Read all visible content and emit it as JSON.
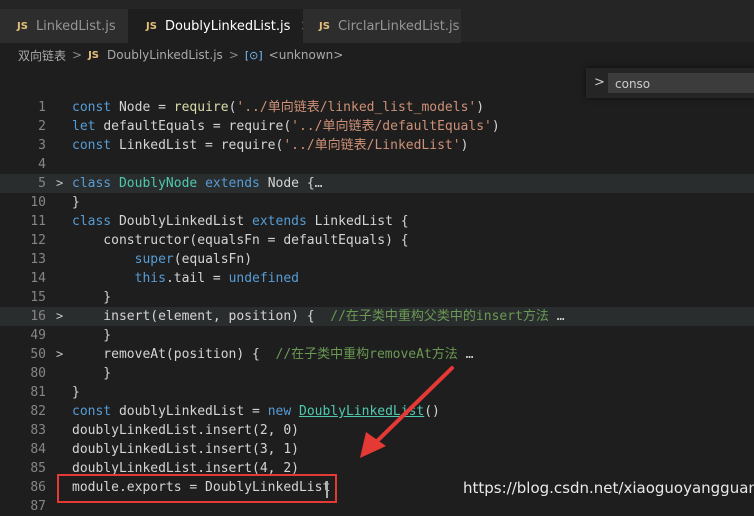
{
  "tabs": [
    {
      "badge": "JS",
      "label": "LinkedList.js"
    },
    {
      "badge": "JS",
      "label": "DoublyLinkedList.js",
      "close": "×"
    },
    {
      "badge": "JS",
      "label": "CirclarLinkedList.js"
    }
  ],
  "breadcrumb": {
    "folder": "双向链表",
    "sep": ">",
    "file_badge": "JS",
    "file": "DoublyLinkedList.js",
    "symbol_icon": "[⊙]",
    "symbol": "<unknown>"
  },
  "find": {
    "chevron": ">",
    "value": "conso"
  },
  "lines": [
    {
      "n": "1",
      "tokens": [
        [
          "kw",
          "const "
        ],
        [
          "plain",
          "Node = "
        ],
        [
          "fn",
          "require"
        ],
        [
          "plain",
          "("
        ],
        [
          "str",
          "'../单向链表/linked_list_models'"
        ],
        [
          "plain",
          ")"
        ]
      ]
    },
    {
      "n": "2",
      "tokens": [
        [
          "kw",
          "let "
        ],
        [
          "plain",
          "defaultEquals = require("
        ],
        [
          "str",
          "'../单向链表/defaultEquals'"
        ],
        [
          "plain",
          ")"
        ]
      ]
    },
    {
      "n": "3",
      "tokens": [
        [
          "kw",
          "const "
        ],
        [
          "plain",
          "LinkedList = require("
        ],
        [
          "str",
          "'../单向链表/LinkedList'"
        ],
        [
          "plain",
          ")"
        ]
      ]
    },
    {
      "n": "4",
      "tokens": []
    },
    {
      "n": "5",
      "fold": true,
      "hl": true,
      "tokens": [
        [
          "kw",
          "class "
        ],
        [
          "cls",
          "DoublyNode "
        ],
        [
          "kw",
          "extends "
        ],
        [
          "plain",
          "Node {"
        ],
        [
          "plain",
          "…"
        ]
      ]
    },
    {
      "n": "10",
      "tokens": [
        [
          "plain",
          "}"
        ]
      ]
    },
    {
      "n": "11",
      "tokens": [
        [
          "kw",
          "class "
        ],
        [
          "plain",
          "DoublyLinkedList "
        ],
        [
          "kw",
          "extends "
        ],
        [
          "plain",
          "LinkedList {"
        ]
      ]
    },
    {
      "n": "12",
      "tokens": [
        [
          "plain",
          "    constructor(equalsFn = defaultEquals) {"
        ]
      ]
    },
    {
      "n": "13",
      "tokens": [
        [
          "plain",
          "        "
        ],
        [
          "kw",
          "super"
        ],
        [
          "plain",
          "(equalsFn)"
        ]
      ]
    },
    {
      "n": "14",
      "tokens": [
        [
          "plain",
          "        "
        ],
        [
          "kw",
          "this"
        ],
        [
          "plain",
          ".tail = "
        ],
        [
          "kw",
          "undefined"
        ]
      ]
    },
    {
      "n": "15",
      "tokens": [
        [
          "plain",
          "    }"
        ]
      ]
    },
    {
      "n": "16",
      "fold": true,
      "hl": true,
      "tokens": [
        [
          "plain",
          "    insert(element, position) {  "
        ],
        [
          "cmt",
          "//在子类中重构父类中的insert方法"
        ],
        [
          "plain",
          " …"
        ]
      ]
    },
    {
      "n": "49",
      "tokens": [
        [
          "plain",
          "    }"
        ]
      ]
    },
    {
      "n": "50",
      "fold": true,
      "tokens": [
        [
          "plain",
          "    removeAt(position) {  "
        ],
        [
          "cmt",
          "//在子类中重构removeAt方法"
        ],
        [
          "plain",
          " …"
        ]
      ]
    },
    {
      "n": "80",
      "tokens": [
        [
          "plain",
          "    }"
        ]
      ]
    },
    {
      "n": "81",
      "tokens": [
        [
          "plain",
          "}"
        ]
      ]
    },
    {
      "n": "82",
      "tokens": [
        [
          "kw",
          "const "
        ],
        [
          "plain",
          "doublyLinkedList = "
        ],
        [
          "kw",
          "new "
        ],
        [
          "link",
          "DoublyLinkedList"
        ],
        [
          "plain",
          "()"
        ]
      ]
    },
    {
      "n": "83",
      "tokens": [
        [
          "plain",
          "doublyLinkedList.insert(2, 0)"
        ]
      ]
    },
    {
      "n": "84",
      "tokens": [
        [
          "plain",
          "doublyLinkedList.insert(3, 1)"
        ]
      ]
    },
    {
      "n": "85",
      "tokens": [
        [
          "plain",
          "doublyLinkedList.insert(4, 2)"
        ]
      ]
    },
    {
      "n": "86",
      "tokens": [
        [
          "plain",
          "module.exports = DoublyLinkedList"
        ]
      ]
    },
    {
      "n": "87",
      "tokens": []
    }
  ],
  "watermark": "https://blog.csdn.net/xiaoguoyangguang",
  "annotation_color": "#e53935"
}
